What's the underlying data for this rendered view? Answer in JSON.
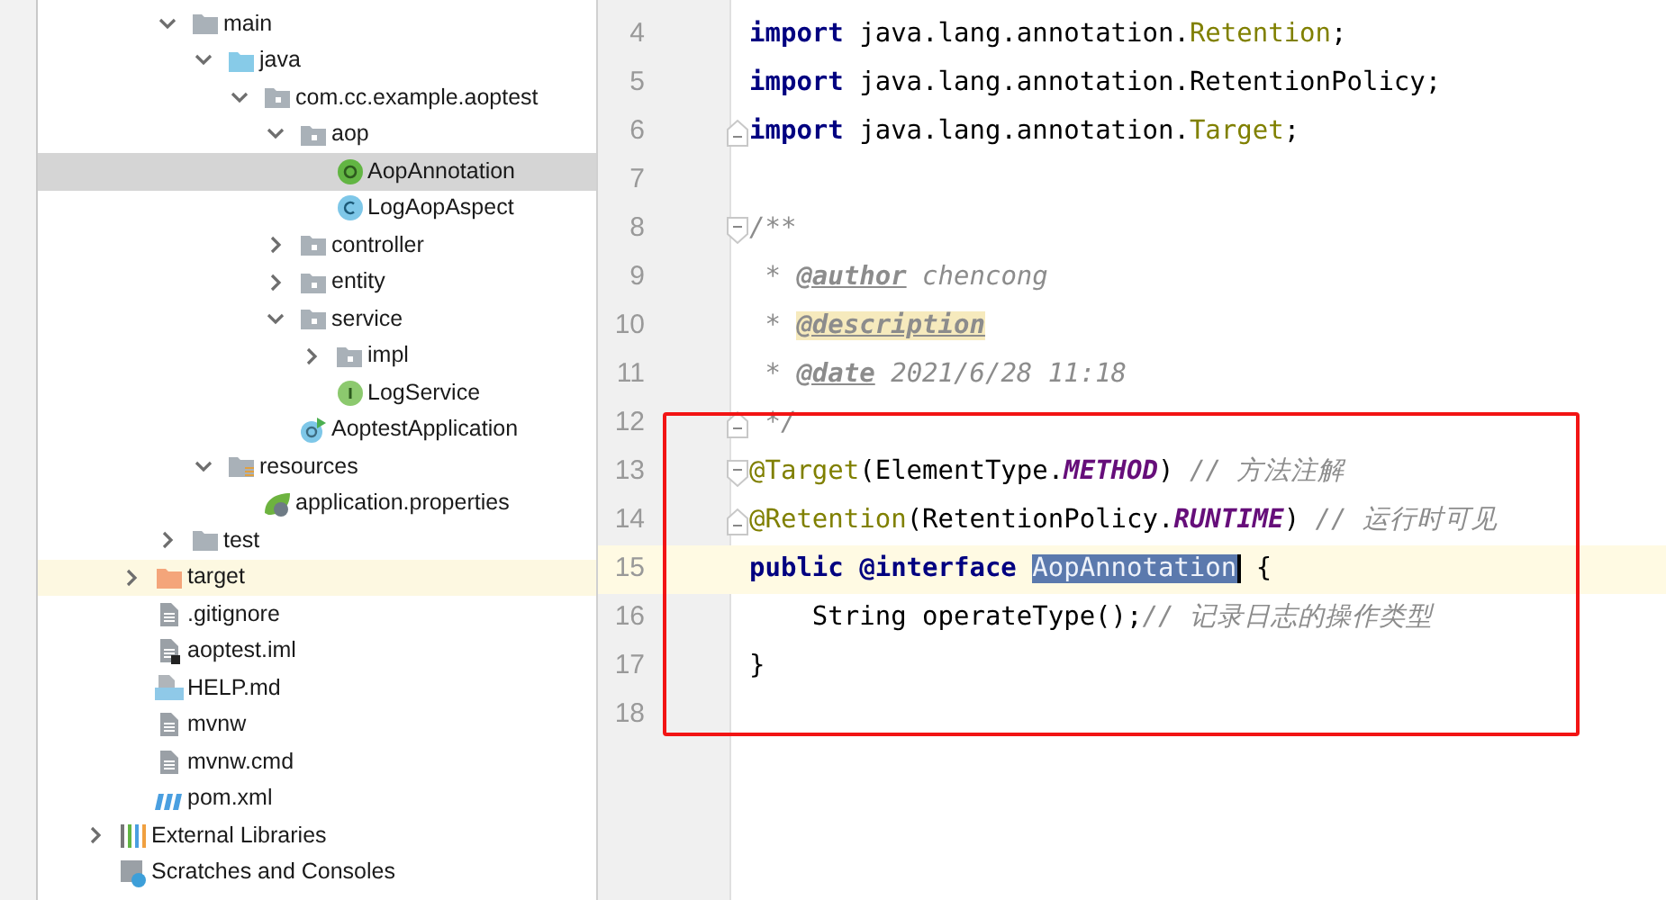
{
  "project_tree": {
    "groups": [
      {
        "items": [
          {
            "label": "main",
            "kind": "folder",
            "expanded": true,
            "selected": false,
            "highlighted": false,
            "children": [
              {
                "label": "java",
                "kind": "source_folder",
                "expanded": true,
                "selected": false,
                "highlighted": false,
                "children": [
                  {
                    "label": "com.cc.example.aoptest",
                    "kind": "package",
                    "expanded": true,
                    "selected": false,
                    "highlighted": false,
                    "children": [
                      {
                        "label": "aop",
                        "kind": "package",
                        "expanded": true,
                        "selected": false,
                        "highlighted": false,
                        "children": [
                          {
                            "label": "AopAnnotation",
                            "kind": "annotation",
                            "selected": true,
                            "highlighted": false
                          },
                          {
                            "label": "LogAopAspect",
                            "kind": "class",
                            "selected": false,
                            "highlighted": false
                          }
                        ]
                      },
                      {
                        "label": "controller",
                        "kind": "package",
                        "expanded": false,
                        "selected": false,
                        "highlighted": false
                      },
                      {
                        "label": "entity",
                        "kind": "package",
                        "expanded": false,
                        "selected": false,
                        "highlighted": false
                      },
                      {
                        "label": "service",
                        "kind": "package",
                        "expanded": true,
                        "selected": false,
                        "highlighted": false,
                        "children": [
                          {
                            "label": "impl",
                            "kind": "package",
                            "expanded": false,
                            "selected": false,
                            "highlighted": false
                          },
                          {
                            "label": "LogService",
                            "kind": "interface",
                            "selected": false,
                            "highlighted": false
                          }
                        ]
                      },
                      {
                        "label": "AoptestApplication",
                        "kind": "spring_app",
                        "selected": false,
                        "highlighted": false
                      }
                    ]
                  }
                ]
              },
              {
                "label": "resources",
                "kind": "resources_folder",
                "expanded": true,
                "selected": false,
                "highlighted": false,
                "children": [
                  {
                    "label": "application.properties",
                    "kind": "properties",
                    "selected": false,
                    "highlighted": false
                  }
                ]
              }
            ]
          },
          {
            "label": "test",
            "kind": "folder",
            "expanded": false,
            "selected": false,
            "highlighted": false
          }
        ]
      },
      {
        "items": [
          {
            "label": "target",
            "kind": "excluded_folder",
            "expanded": false,
            "selected": false,
            "highlighted": true
          },
          {
            "label": ".gitignore",
            "kind": "text_file",
            "selected": false,
            "highlighted": false
          },
          {
            "label": "aoptest.iml",
            "kind": "iml",
            "selected": false,
            "highlighted": false
          },
          {
            "label": "HELP.md",
            "kind": "markdown",
            "selected": false,
            "highlighted": false
          },
          {
            "label": "mvnw",
            "kind": "text_file",
            "selected": false,
            "highlighted": false
          },
          {
            "label": "mvnw.cmd",
            "kind": "text_file",
            "selected": false,
            "highlighted": false
          },
          {
            "label": "pom.xml",
            "kind": "maven",
            "selected": false,
            "highlighted": false
          }
        ]
      },
      {
        "items": [
          {
            "label": "External Libraries",
            "kind": "libraries",
            "expanded": false,
            "selected": false,
            "highlighted": false
          },
          {
            "label": "Scratches and Consoles",
            "kind": "scratches",
            "selected": false,
            "highlighted": false
          }
        ]
      }
    ]
  },
  "editor": {
    "lines": [
      {
        "number": "4",
        "current": false,
        "fold_start": false,
        "fold_end": false,
        "tokens": [
          {
            "text": "import",
            "kind": "keyword"
          },
          {
            "text": " java.lang.annotation.",
            "kind": "plain"
          },
          {
            "text": "Retention",
            "kind": "annotation_type"
          },
          {
            "text": ";",
            "kind": "plain"
          }
        ]
      },
      {
        "number": "5",
        "current": false,
        "fold_start": false,
        "fold_end": false,
        "tokens": [
          {
            "text": "import",
            "kind": "keyword"
          },
          {
            "text": " java.lang.annotation.RetentionPolicy;",
            "kind": "plain"
          }
        ]
      },
      {
        "number": "6",
        "current": false,
        "fold_start": false,
        "fold_end": true,
        "tokens": [
          {
            "text": "import",
            "kind": "keyword"
          },
          {
            "text": " java.lang.annotation.",
            "kind": "plain"
          },
          {
            "text": "Target",
            "kind": "annotation_type"
          },
          {
            "text": ";",
            "kind": "plain"
          }
        ]
      },
      {
        "number": "7",
        "current": false,
        "fold_start": false,
        "fold_end": false
      },
      {
        "number": "8",
        "current": false,
        "fold_start": true,
        "fold_end": false,
        "tokens": [
          {
            "text": "/**",
            "kind": "comment"
          }
        ]
      },
      {
        "number": "9",
        "current": false,
        "fold_start": false,
        "fold_end": false,
        "tokens": [
          {
            "text": " * ",
            "kind": "comment"
          },
          {
            "text": "@author",
            "kind": "doc_tag"
          },
          {
            "text": " chencong",
            "kind": "comment"
          }
        ]
      },
      {
        "number": "10",
        "current": false,
        "fold_start": false,
        "fold_end": false,
        "tokens": [
          {
            "text": " * ",
            "kind": "comment"
          },
          {
            "text": "@description",
            "kind": "doc_tag_marked"
          }
        ]
      },
      {
        "number": "11",
        "current": false,
        "fold_start": false,
        "fold_end": false,
        "tokens": [
          {
            "text": " * ",
            "kind": "comment"
          },
          {
            "text": "@date",
            "kind": "doc_tag"
          },
          {
            "text": " 2021/6/28 11:18",
            "kind": "comment"
          }
        ]
      },
      {
        "number": "12",
        "current": false,
        "fold_start": false,
        "fold_end": true,
        "tokens": [
          {
            "text": " */",
            "kind": "comment"
          }
        ]
      },
      {
        "number": "13",
        "current": false,
        "fold_start": true,
        "fold_end": false,
        "tokens": [
          {
            "text": "@Target",
            "kind": "annotation_type"
          },
          {
            "text": "(ElementType.",
            "kind": "plain"
          },
          {
            "text": "METHOD",
            "kind": "constant"
          },
          {
            "text": ") ",
            "kind": "plain"
          },
          {
            "text": "// 方法注解",
            "kind": "comment"
          }
        ]
      },
      {
        "number": "14",
        "current": false,
        "fold_start": false,
        "fold_end": true,
        "tokens": [
          {
            "text": "@Retention",
            "kind": "annotation_type"
          },
          {
            "text": "(RetentionPolicy.",
            "kind": "plain"
          },
          {
            "text": "RUNTIME",
            "kind": "constant"
          },
          {
            "text": ") ",
            "kind": "plain"
          },
          {
            "text": "// 运行时可见",
            "kind": "comment"
          }
        ]
      },
      {
        "number": "15",
        "current": true,
        "fold_start": false,
        "fold_end": false,
        "tokens": [
          {
            "text": "public @interface",
            "kind": "keyword"
          },
          {
            "text": "AopAnnotation",
            "kind": "selection"
          },
          {
            "text": " {",
            "kind": "plain"
          }
        ]
      },
      {
        "number": "16",
        "current": false,
        "fold_start": false,
        "fold_end": false,
        "tokens": [
          {
            "text": "    String operateType();",
            "kind": "plain"
          },
          {
            "text": "// 记录日志的操作类型",
            "kind": "comment"
          }
        ]
      },
      {
        "number": "17",
        "current": false,
        "fold_start": false,
        "fold_end": false,
        "tokens": [
          {
            "text": "}",
            "kind": "plain"
          }
        ]
      },
      {
        "number": "18",
        "current": false,
        "fold_start": false,
        "fold_end": false
      }
    ]
  }
}
